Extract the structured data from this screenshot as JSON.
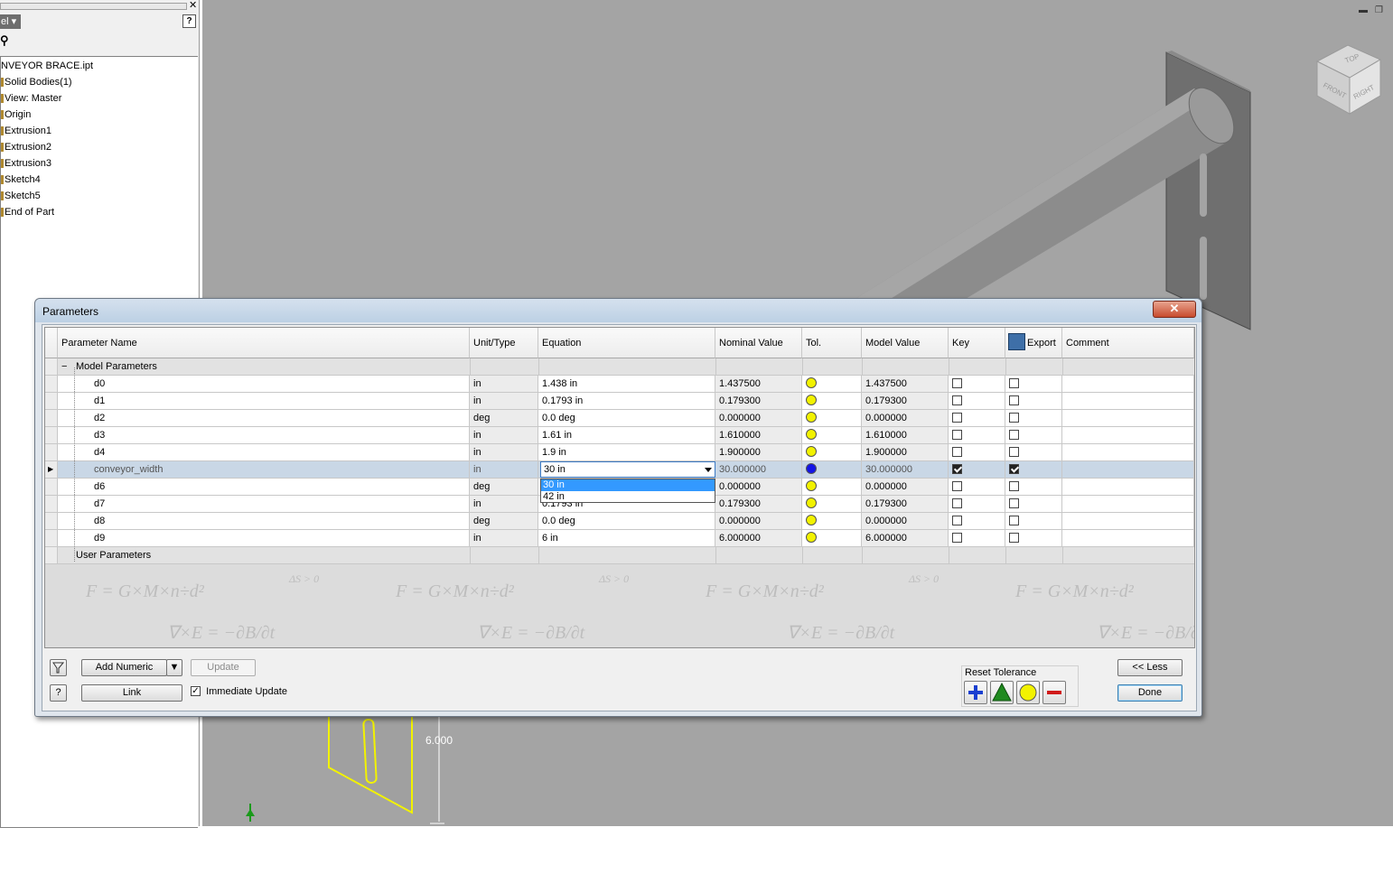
{
  "browser": {
    "mode_label": "el",
    "tree": [
      "NVEYOR BRACE.ipt",
      "Solid Bodies(1)",
      "View: Master",
      "Origin",
      "Extrusion1",
      "Extrusion2",
      "Extrusion3",
      "Sketch4",
      "Sketch5",
      "End of Part"
    ]
  },
  "viewcube": {
    "top": "TOP",
    "front": "FRONT",
    "right": "RIGHT"
  },
  "sketch": {
    "dimension": "6.000"
  },
  "dialog": {
    "title": "Parameters",
    "columns": [
      "Parameter Name",
      "Unit/Type",
      "Equation",
      "Nominal Value",
      "Tol.",
      "Model Value",
      "Key",
      "Export",
      "Comment"
    ],
    "groups": {
      "model": "Model Parameters",
      "user": "User Parameters"
    },
    "rows": [
      {
        "name": "d0",
        "unit": "in",
        "equation": "1.438 in",
        "nominal": "1.437500",
        "tol": "#f2f200",
        "model": "1.437500",
        "key": false,
        "export": false
      },
      {
        "name": "d1",
        "unit": "in",
        "equation": "0.1793 in",
        "nominal": "0.179300",
        "tol": "#f2f200",
        "model": "0.179300",
        "key": false,
        "export": false
      },
      {
        "name": "d2",
        "unit": "deg",
        "equation": "0.0 deg",
        "nominal": "0.000000",
        "tol": "#f2f200",
        "model": "0.000000",
        "key": false,
        "export": false
      },
      {
        "name": "d3",
        "unit": "in",
        "equation": "1.61 in",
        "nominal": "1.610000",
        "tol": "#f2f200",
        "model": "1.610000",
        "key": false,
        "export": false
      },
      {
        "name": "d4",
        "unit": "in",
        "equation": "1.9 in",
        "nominal": "1.900000",
        "tol": "#f2f200",
        "model": "1.900000",
        "key": false,
        "export": false
      },
      {
        "name": "conveyor_width",
        "unit": "in",
        "equation": "30 in",
        "nominal": "30.000000",
        "tol": "#1414e6",
        "model": "30.000000",
        "key": true,
        "export": true
      },
      {
        "name": "d6",
        "unit": "deg",
        "equation": "",
        "nominal": "0.000000",
        "tol": "#f2f200",
        "model": "0.000000",
        "key": false,
        "export": false
      },
      {
        "name": "d7",
        "unit": "in",
        "equation": "0.1793 in",
        "nominal": "0.179300",
        "tol": "#f2f200",
        "model": "0.179300",
        "key": false,
        "export": false
      },
      {
        "name": "d8",
        "unit": "deg",
        "equation": "0.0 deg",
        "nominal": "0.000000",
        "tol": "#f2f200",
        "model": "0.000000",
        "key": false,
        "export": false
      },
      {
        "name": "d9",
        "unit": "in",
        "equation": "6 in",
        "nominal": "6.000000",
        "tol": "#f2f200",
        "model": "6.000000",
        "key": false,
        "export": false
      }
    ],
    "dropdown": {
      "options": [
        "30 in",
        "42 in"
      ],
      "selected": "30 in"
    },
    "buttons": {
      "add_numeric": "Add Numeric",
      "update": "Update",
      "link": "Link",
      "immediate_update": "Immediate Update",
      "immediate_update_checked": true,
      "less": "<< Less",
      "done": "Done",
      "filter_icon": "filter-icon",
      "help_icon": "help-icon"
    },
    "reset_tolerance": {
      "label": "Reset Tolerance",
      "icons": [
        "upper-tolerance-icon",
        "median-tolerance-icon",
        "nominal-tolerance-icon",
        "lower-tolerance-icon"
      ]
    },
    "formula_watermark": [
      "F = G×M×n÷d²",
      "∇×E = −∂B/∂t",
      "ΔS > 0"
    ]
  },
  "colors": {
    "viewport": "#a4a4a4",
    "dialog_frame": "#dfe5ec",
    "tolerance_yellow": "#f2f200",
    "tolerance_blue": "#1414e6",
    "selected_row": "#c9d7e6"
  }
}
